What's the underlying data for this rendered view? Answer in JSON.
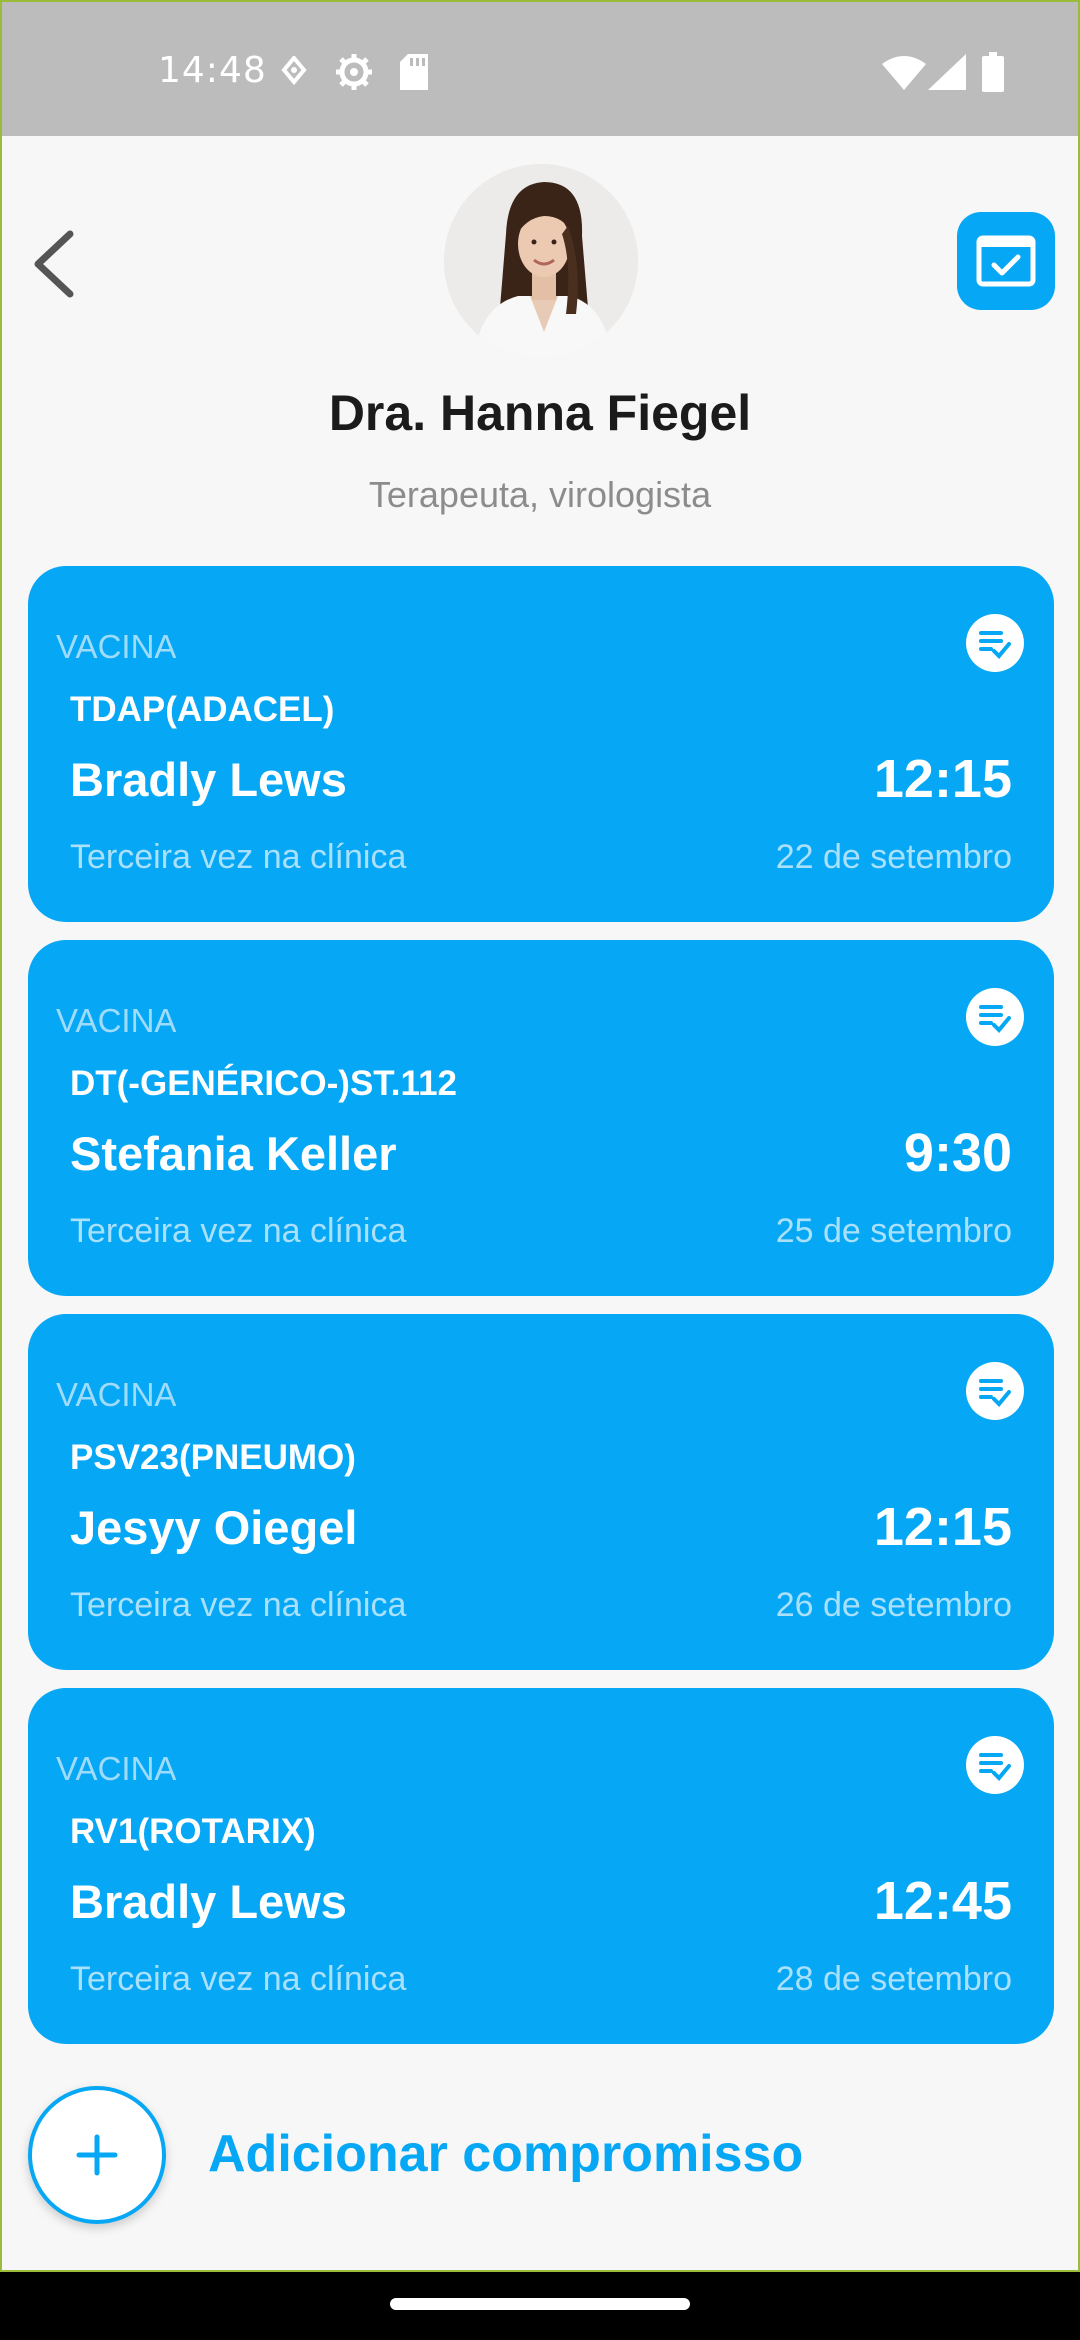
{
  "status_bar": {
    "time": "14:48",
    "icons": [
      "location-icon",
      "settings-icon",
      "sd-card-icon",
      "wifi-icon",
      "signal-icon",
      "battery-icon"
    ]
  },
  "header": {
    "doctor_name": "Dra. Hanna Fiegel",
    "doctor_role": "Terapeuta, virologista"
  },
  "appointments": [
    {
      "category": "VACINA",
      "vaccine": "TDAP(ADACEL)",
      "patient": "Bradly Lews",
      "time": "12:15",
      "note": "Terceira vez na clínica",
      "date": "22 de setembro"
    },
    {
      "category": "VACINA",
      "vaccine": "DT(-GENÉRICO-)ST.112",
      "patient": "Stefania Keller",
      "time": "9:30",
      "note": "Terceira vez na clínica",
      "date": "25 de setembro"
    },
    {
      "category": "VACINA",
      "vaccine": "PSV23(PNEUMO)",
      "patient": "Jesyy Oiegel",
      "time": "12:15",
      "note": "Terceira vez na clínica",
      "date": "26 de setembro"
    },
    {
      "category": "VACINA",
      "vaccine": "RV1(ROTARIX)",
      "patient": "Bradly Lews",
      "time": "12:45",
      "note": "Terceira vez na clínica",
      "date": "28 de setembro"
    }
  ],
  "add_appointment": {
    "label": "Adicionar compromisso"
  },
  "colors": {
    "accent": "#06a7f4",
    "status_bar": "#bcbcbc",
    "background": "#f7f7f7"
  }
}
